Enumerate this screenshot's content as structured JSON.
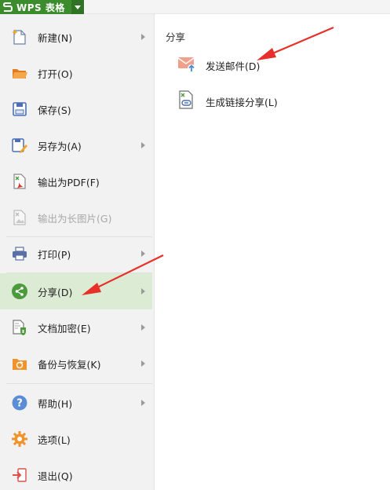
{
  "app": {
    "title": "WPS 表格"
  },
  "menu": {
    "new": "新建(N)",
    "open": "打开(O)",
    "save": "保存(S)",
    "save_as": "另存为(A)",
    "export_pdf": "输出为PDF(F)",
    "export_image": "输出为长图片(G)",
    "print": "打印(P)",
    "share": "分享(D)",
    "encrypt": "文档加密(E)",
    "backup": "备份与恢复(K)",
    "help": "帮助(H)",
    "options": "选项(L)",
    "exit": "退出(Q)"
  },
  "submenu": {
    "title": "分享",
    "send_email": "发送邮件(D)",
    "share_link": "生成链接分享(L)"
  },
  "colors": {
    "brand": "#3c8c2e",
    "selected_bg": "#dcebd3",
    "annotation_arrow": "#e8302a"
  }
}
